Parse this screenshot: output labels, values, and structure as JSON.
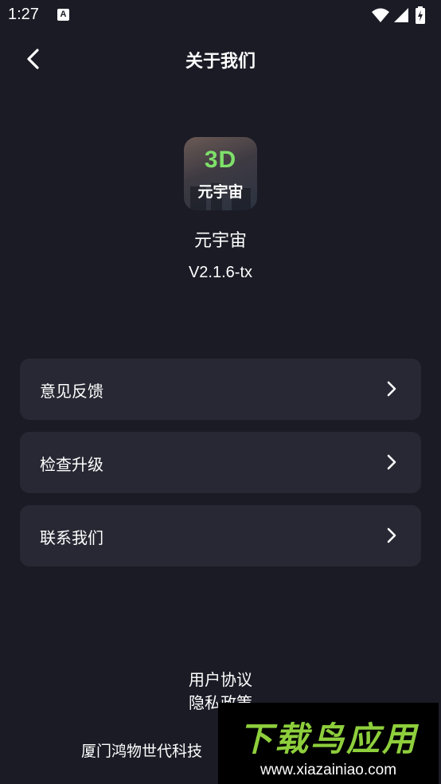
{
  "status_bar": {
    "time": "1:27",
    "notification_badge": "A",
    "icons": [
      "wifi-icon",
      "signal-icon",
      "battery-charging-icon"
    ]
  },
  "header": {
    "title": "关于我们"
  },
  "app": {
    "icon_text_top": "3D",
    "icon_text_bottom": "元宇宙",
    "name": "元宇宙",
    "version": "V2.1.6-tx"
  },
  "menu": {
    "items": [
      {
        "label": "意见反馈"
      },
      {
        "label": "检查升级"
      },
      {
        "label": "联系我们"
      }
    ]
  },
  "footer": {
    "user_agreement": "用户协议",
    "privacy_policy": "隐私政策",
    "company": "厦门鸿物世代科技"
  },
  "watermark": {
    "brand": "下载鸟应用",
    "url": "www.xiazainiao.com"
  },
  "colors": {
    "background": "#1b1b26",
    "card": "#272833",
    "accent_green": "#7ee06a"
  }
}
